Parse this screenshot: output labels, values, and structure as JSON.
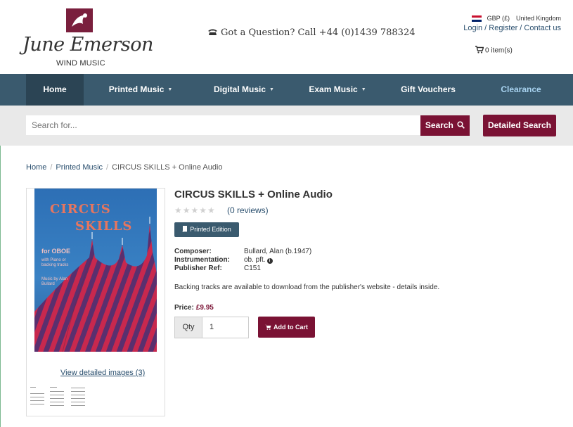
{
  "header": {
    "logo_script": "June Emerson",
    "logo_sub": "WIND MUSIC",
    "phone": "Got a Question? Call +44 (0)1439 788324",
    "currency": "GBP (£)",
    "country": "United Kingdom",
    "account_links": "Login / Register / Contact us",
    "cart": "0 item(s)"
  },
  "nav": {
    "items": [
      {
        "label": "Home"
      },
      {
        "label": "Printed Music"
      },
      {
        "label": "Digital Music"
      },
      {
        "label": "Exam Music"
      },
      {
        "label": "Gift Vouchers"
      },
      {
        "label": "Clearance"
      }
    ]
  },
  "search": {
    "placeholder": "Search for...",
    "button": "Search",
    "detailed": "Detailed Search"
  },
  "breadcrumb": {
    "home": "Home",
    "category": "Printed Music",
    "current": "CIRCUS SKILLS + Online Audio"
  },
  "product": {
    "cover": {
      "title_1": "CIRCUS",
      "title_2": "SKILLS",
      "instrument": "for OBOE",
      "subtitle": "with Piano or backing tracks",
      "author": "Music by Alan Bullard"
    },
    "view_images": "View detailed images (3)",
    "title": "CIRCUS SKILLS + Online Audio",
    "stars": "★★★★★",
    "reviews": "(0 reviews)",
    "edition": "Printed Edition",
    "composer_label": "Composer:",
    "composer": "Bullard, Alan (b.1947)",
    "instrumentation_label": "Instrumentation:",
    "instrumentation": "ob. pft.",
    "publisher_label": "Publisher Ref:",
    "publisher_ref": "C151",
    "description": "Backing tracks are available to download from the publisher's website - details inside.",
    "price_label": "Price:",
    "price": "£9.95",
    "qty_label": "Qty",
    "qty_value": "1",
    "add_to_cart": "Add to Cart"
  },
  "colors": {
    "nav_bg": "#3a5a6e",
    "brand": "#7a1234",
    "clearance": "#a8d3f0"
  }
}
